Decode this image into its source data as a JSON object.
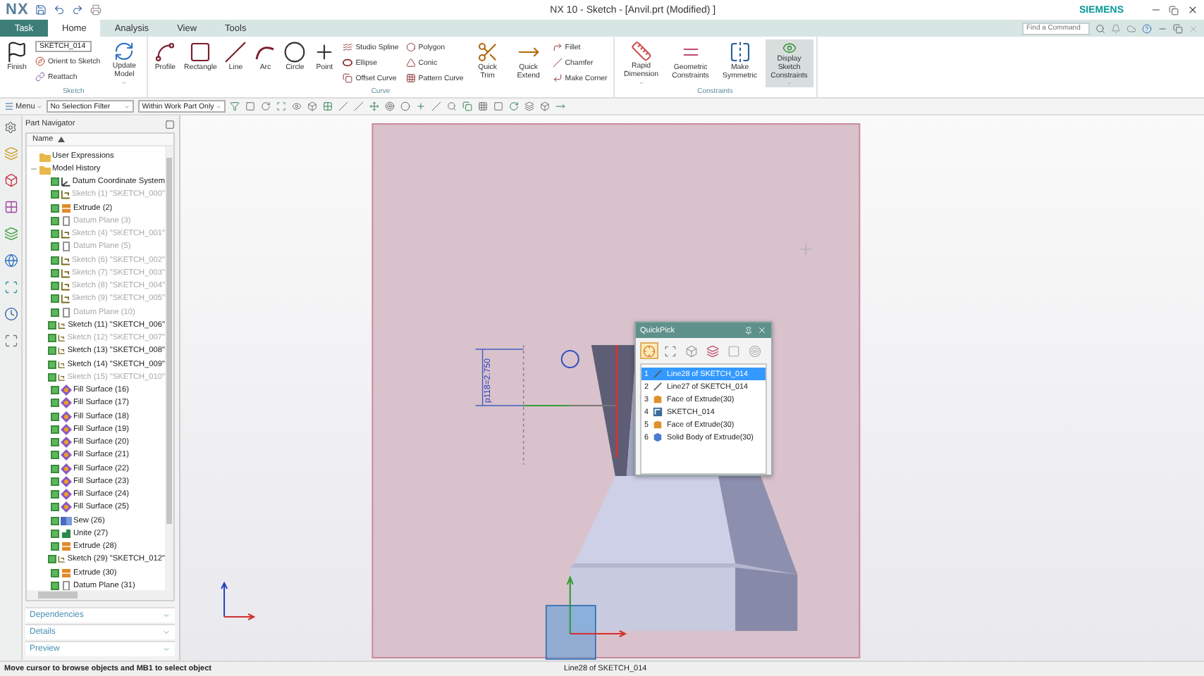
{
  "title_bar": {
    "logo": "NX",
    "title": "NX 10 - Sketch - [Anvil.prt (Modified) ]",
    "brand": "SIEMENS"
  },
  "tabs": [
    {
      "label": "Task",
      "kind": "task",
      "selected": false
    },
    {
      "label": "Home",
      "kind": "tab",
      "selected": true
    },
    {
      "label": "Analysis",
      "kind": "tab",
      "selected": false
    },
    {
      "label": "View",
      "kind": "tab",
      "selected": false
    },
    {
      "label": "Tools",
      "kind": "tab",
      "selected": false
    }
  ],
  "command_search": {
    "placeholder": "Find a Command"
  },
  "ribbon": [
    {
      "label": "Sketch",
      "items": [
        {
          "kind": "large",
          "label": "Finish"
        },
        {
          "kind": "column",
          "entries": [
            {
              "kind": "combo",
              "value": "SKETCH_014"
            },
            {
              "kind": "small",
              "label": "Orient to Sketch"
            },
            {
              "kind": "small",
              "label": "Reattach"
            }
          ]
        },
        {
          "kind": "large",
          "label": "Update Model",
          "dropdown": true
        }
      ]
    },
    {
      "label": "Curve",
      "items": [
        {
          "kind": "large",
          "label": "Profile"
        },
        {
          "kind": "large",
          "label": "Rectangle"
        },
        {
          "kind": "large",
          "label": "Line"
        },
        {
          "kind": "large",
          "label": "Arc"
        },
        {
          "kind": "large",
          "label": "Circle"
        },
        {
          "kind": "large",
          "label": "Point"
        },
        {
          "kind": "column",
          "entries": [
            {
              "kind": "small",
              "label": "Studio Spline"
            },
            {
              "kind": "small",
              "label": "Ellipse"
            },
            {
              "kind": "small",
              "label": "Offset Curve"
            }
          ]
        },
        {
          "kind": "column",
          "entries": [
            {
              "kind": "small",
              "label": "Polygon"
            },
            {
              "kind": "small",
              "label": "Conic"
            },
            {
              "kind": "small",
              "label": "Pattern Curve"
            }
          ]
        },
        {
          "kind": "large",
          "label": "Quick Trim"
        },
        {
          "kind": "large",
          "label": "Quick Extend"
        },
        {
          "kind": "column",
          "entries": [
            {
              "kind": "small",
              "label": "Fillet"
            },
            {
              "kind": "small",
              "label": "Chamfer"
            },
            {
              "kind": "small",
              "label": "Make Corner"
            }
          ]
        }
      ]
    },
    {
      "label": "Constraints",
      "items": [
        {
          "kind": "large",
          "label": "Rapid Dimension",
          "dropdown": true,
          "on": false
        },
        {
          "kind": "large",
          "label": "Geometric Constraints",
          "on": false
        },
        {
          "kind": "large",
          "label": "Make Symmetric",
          "on": false
        },
        {
          "kind": "large",
          "label": "Display Sketch Constraints",
          "dropdown": true,
          "on": true
        }
      ]
    }
  ],
  "toolbar": {
    "menu": "Menu",
    "selection_filter": "No Selection Filter",
    "scope": "Within Work Part Only"
  },
  "part_navigator": {
    "title": "Part Navigator",
    "column": "Name",
    "tree": [
      {
        "label": "User Expressions",
        "kind": "folder"
      },
      {
        "label": "Model History",
        "kind": "folder",
        "expanded": true,
        "children": [
          {
            "label": "Datum Coordinate System",
            "kind": "csys",
            "checked": true,
            "dimmed": false
          },
          {
            "label": "Sketch (1) \"SKETCH_000\"",
            "kind": "sketch",
            "checked": true,
            "dimmed": true
          },
          {
            "label": "Extrude (2)",
            "kind": "extrude",
            "checked": true,
            "dimmed": false
          },
          {
            "label": "Datum Plane (3)",
            "kind": "datum-plane",
            "checked": true,
            "dimmed": true
          },
          {
            "label": "Sketch (4) \"SKETCH_001\"",
            "kind": "sketch",
            "checked": true,
            "dimmed": true
          },
          {
            "label": "Datum Plane (5)",
            "kind": "datum-plane",
            "checked": true,
            "dimmed": true
          },
          {
            "label": "Sketch (6) \"SKETCH_002\"",
            "kind": "sketch",
            "checked": true,
            "dimmed": true
          },
          {
            "label": "Sketch (7) \"SKETCH_003\"",
            "kind": "sketch",
            "checked": true,
            "dimmed": true
          },
          {
            "label": "Sketch (8) \"SKETCH_004\"",
            "kind": "sketch",
            "checked": true,
            "dimmed": true
          },
          {
            "label": "Sketch (9) \"SKETCH_005\"",
            "kind": "sketch",
            "checked": true,
            "dimmed": true
          },
          {
            "label": "Datum Plane (10)",
            "kind": "datum-plane",
            "checked": true,
            "dimmed": true
          },
          {
            "label": "Sketch (11) \"SKETCH_006\"",
            "kind": "sketch",
            "checked": true,
            "dimmed": false
          },
          {
            "label": "Sketch (12) \"SKETCH_007\"",
            "kind": "sketch",
            "checked": true,
            "dimmed": true
          },
          {
            "label": "Sketch (13) \"SKETCH_008\"",
            "kind": "sketch",
            "checked": true,
            "dimmed": false
          },
          {
            "label": "Sketch (14) \"SKETCH_009\"",
            "kind": "sketch",
            "checked": true,
            "dimmed": false
          },
          {
            "label": "Sketch (15) \"SKETCH_010\"",
            "kind": "sketch",
            "checked": true,
            "dimmed": true
          },
          {
            "label": "Fill Surface (16)",
            "kind": "fill-surface",
            "checked": true,
            "dimmed": false
          },
          {
            "label": "Fill Surface (17)",
            "kind": "fill-surface",
            "checked": true,
            "dimmed": false
          },
          {
            "label": "Fill Surface (18)",
            "kind": "fill-surface",
            "checked": true,
            "dimmed": false
          },
          {
            "label": "Fill Surface (19)",
            "kind": "fill-surface",
            "checked": true,
            "dimmed": false
          },
          {
            "label": "Fill Surface (20)",
            "kind": "fill-surface",
            "checked": true,
            "dimmed": false
          },
          {
            "label": "Fill Surface (21)",
            "kind": "fill-surface",
            "checked": true,
            "dimmed": false
          },
          {
            "label": "Fill Surface (22)",
            "kind": "fill-surface",
            "checked": true,
            "dimmed": false
          },
          {
            "label": "Fill Surface (23)",
            "kind": "fill-surface",
            "checked": true,
            "dimmed": false
          },
          {
            "label": "Fill Surface (24)",
            "kind": "fill-surface",
            "checked": true,
            "dimmed": false
          },
          {
            "label": "Fill Surface (25)",
            "kind": "fill-surface",
            "checked": true,
            "dimmed": false
          },
          {
            "label": "Sew (26)",
            "kind": "sew",
            "checked": true,
            "dimmed": false
          },
          {
            "label": "Unite (27)",
            "kind": "unite",
            "checked": true,
            "dimmed": false
          },
          {
            "label": "Extrude (28)",
            "kind": "extrude",
            "checked": true,
            "dimmed": false
          },
          {
            "label": "Sketch (29) \"SKETCH_012\"",
            "kind": "sketch",
            "checked": true,
            "dimmed": false
          },
          {
            "label": "Extrude (30)",
            "kind": "extrude",
            "checked": true,
            "dimmed": false
          },
          {
            "label": "Datum Plane (31)",
            "kind": "datum-plane",
            "checked": true,
            "dimmed": false
          }
        ]
      }
    ],
    "sections": [
      {
        "label": "Dependencies",
        "expanded": false
      },
      {
        "label": "Details",
        "expanded": false
      },
      {
        "label": "Preview",
        "expanded": false
      }
    ]
  },
  "graphics": {
    "dimension": "p118=2.750"
  },
  "quickpick": {
    "title": "QuickPick",
    "filters": [
      {
        "selected": true
      },
      {
        "selected": false
      },
      {
        "selected": false
      },
      {
        "selected": false
      },
      {
        "selected": false
      },
      {
        "selected": false
      }
    ],
    "items": [
      {
        "number": "1",
        "label": "Line28 of SKETCH_014",
        "kind": "line",
        "selected": true
      },
      {
        "number": "2",
        "label": "Line27 of SKETCH_014",
        "kind": "line",
        "selected": false
      },
      {
        "number": "3",
        "label": "Face of Extrude(30)",
        "kind": "face",
        "selected": false
      },
      {
        "number": "4",
        "label": "SKETCH_014",
        "kind": "sketch",
        "selected": false
      },
      {
        "number": "5",
        "label": "Face of Extrude(30)",
        "kind": "face",
        "selected": false
      },
      {
        "number": "6",
        "label": "Solid Body of Extrude(30)",
        "kind": "body",
        "selected": false
      }
    ]
  },
  "status_bar": {
    "prompt": "Move cursor to browse objects and MB1 to select object",
    "selection": "Line28 of SKETCH_014"
  }
}
